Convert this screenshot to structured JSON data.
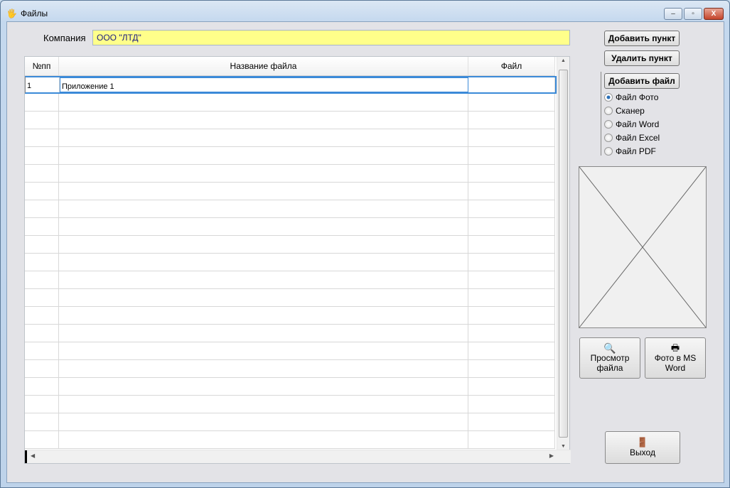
{
  "window": {
    "title": "Файлы",
    "minimize": "–",
    "maximize": "▫",
    "close": "X"
  },
  "company": {
    "label": "Компания",
    "value": "ООО \"ЛТД\""
  },
  "table": {
    "columns": [
      "№пп",
      "Название файла",
      "Файл"
    ],
    "rows": [
      {
        "num": "1",
        "name": "Приложение 1",
        "file": ""
      }
    ],
    "empty_rows": 20
  },
  "buttons": {
    "add_item": "Добавить пункт",
    "delete_item": "Удалить пункт",
    "add_file": "Добавить файл",
    "view_file": "Просмотр файла",
    "photo_word": "Фото в MS Word",
    "exit": "Выход"
  },
  "file_types": {
    "selected": 0,
    "options": [
      "Файл Фото",
      "Сканер",
      "Файл Word",
      "Файл Excel",
      "Файл PDF"
    ]
  }
}
